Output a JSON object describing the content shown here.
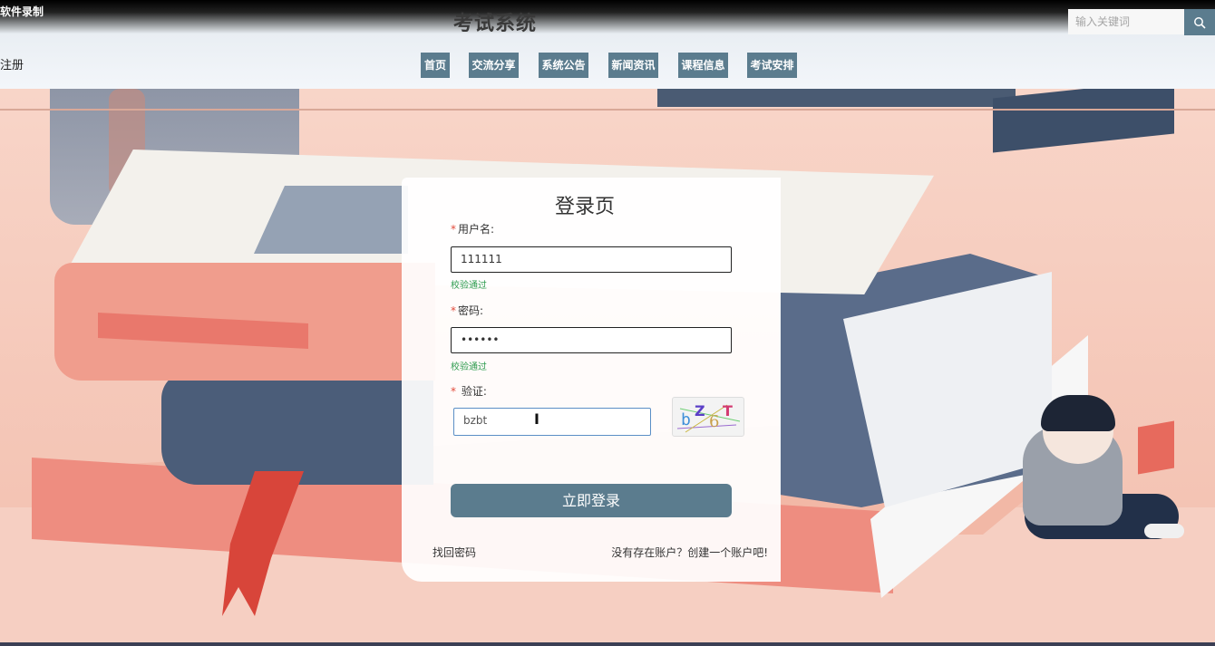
{
  "recording_label": "软件录制",
  "header": {
    "site_title": "考试系统",
    "search_placeholder": "输入关键词",
    "register_link": "注册",
    "nav": [
      {
        "label": "首页"
      },
      {
        "label": "交流分享"
      },
      {
        "label": "系统公告"
      },
      {
        "label": "新闻资讯"
      },
      {
        "label": "课程信息"
      },
      {
        "label": "考试安排"
      }
    ]
  },
  "login": {
    "title": "登录页",
    "username_label": "用户名:",
    "username_value": "111111",
    "username_status": "校验通过",
    "password_label": "密码:",
    "password_value": "••••••",
    "password_status": "校验通过",
    "captcha_label": "验证:",
    "captcha_value": "bzbt",
    "captcha_chars": [
      "b",
      "Z",
      "6",
      "T"
    ],
    "submit_label": "立即登录",
    "forgot_link": "找回密码",
    "signup_link": "没有存在账户？创建一个账户吧!"
  },
  "colors": {
    "accent": "#5b7c8e",
    "success": "#2e9c4f",
    "required": "#e24b3b"
  }
}
